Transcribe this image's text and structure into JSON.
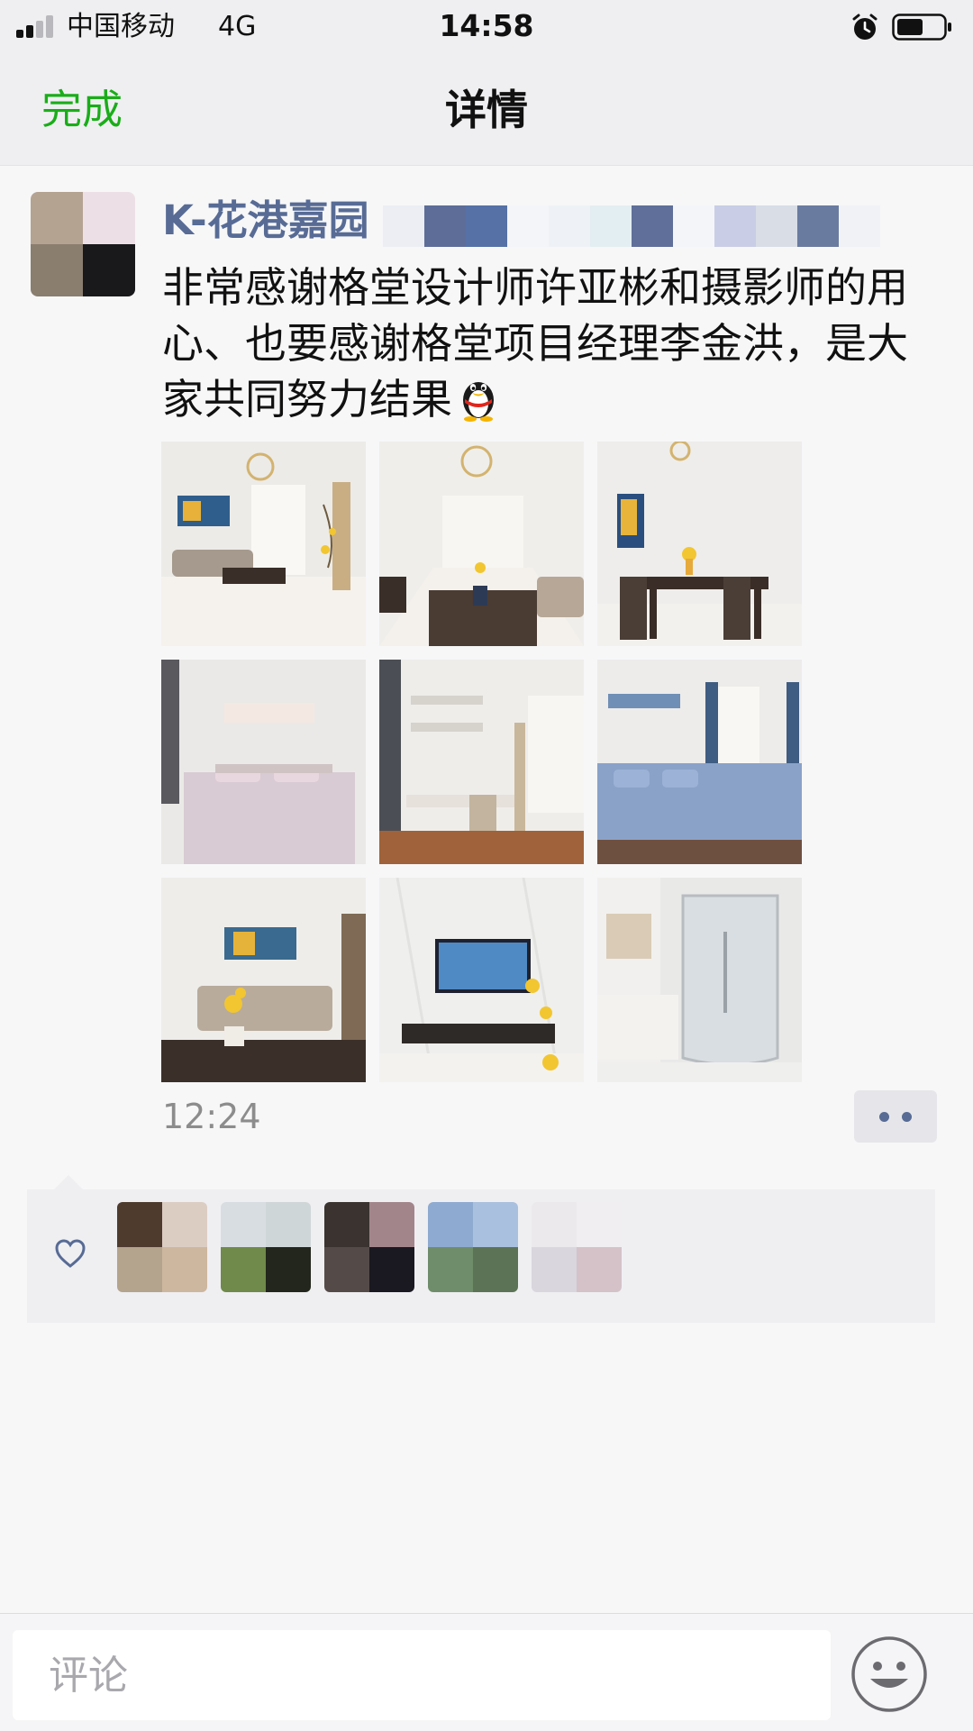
{
  "status_bar": {
    "carrier": "中国移动",
    "network": "4G",
    "time": "14:58"
  },
  "nav": {
    "done_label": "完成",
    "title": "详情"
  },
  "post": {
    "author": "K-花港嘉园",
    "text": "非常感谢格堂设计师许亚彬和摄影师的用心、也要感谢格堂项目经理李金洪，是大家共同努力结果",
    "emoji": "penguin-icon",
    "photo_count": 9,
    "time": "12:24"
  },
  "likes": {
    "icon": "heart-icon",
    "count": 5
  },
  "comment_bar": {
    "placeholder": "评论",
    "emoji_icon": "smiley-icon"
  },
  "colors": {
    "accent_green": "#1aad19",
    "link_blue": "#576b95"
  }
}
